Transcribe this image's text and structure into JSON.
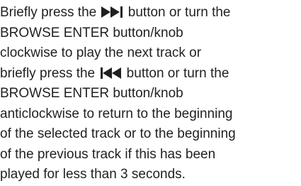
{
  "instruction": {
    "line1": {
      "before_icon": "Briefly press the ",
      "icon": "skip-next-icon",
      "after_icon": " button or turn the"
    },
    "line2": "BROWSE ENTER button/knob",
    "line3": "clockwise to play the next track or",
    "line4": {
      "before_icon": "briefly press the ",
      "icon": "skip-previous-icon",
      "after_icon": " button or turn the"
    },
    "line5": "BROWSE ENTER button/knob",
    "line6": "anticlockwise to return to the beginning",
    "line7": "of the selected track or to the beginning",
    "line8": "of the previous track if this has been",
    "line9": "played for less than 3 seconds.",
    "text_color": "#231f20"
  }
}
